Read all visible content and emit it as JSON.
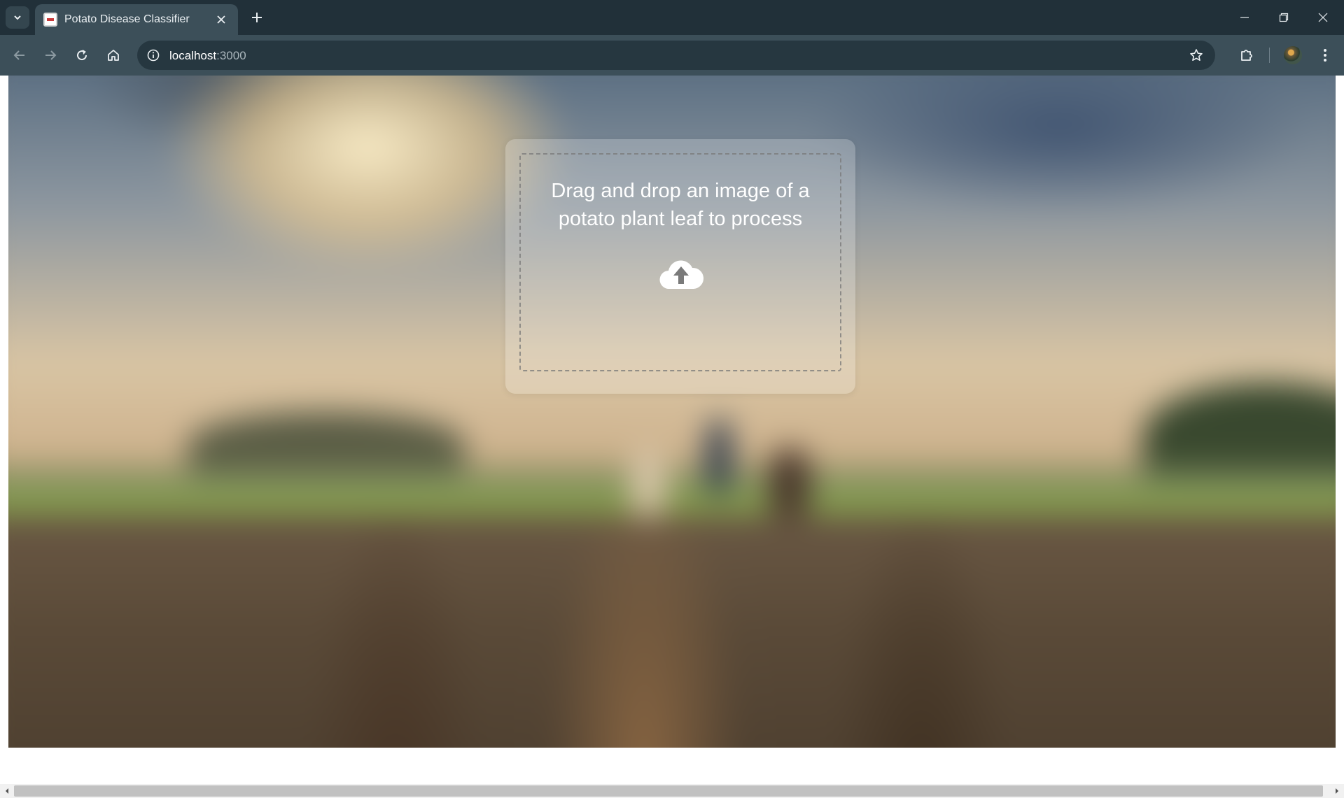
{
  "browser": {
    "tab": {
      "title": "Potato Disease Classifier"
    },
    "address": {
      "host": "localhost",
      "port": ":3000"
    }
  },
  "icons": {
    "tab_search": "chevron-down-icon",
    "close_tab": "close-icon",
    "new_tab": "plus-icon",
    "back": "arrow-left-icon",
    "forward": "arrow-right-icon",
    "reload": "reload-icon",
    "home": "home-icon",
    "site_info": "info-icon",
    "bookmark": "star-icon",
    "extensions": "puzzle-icon",
    "menu": "kebab-menu-icon",
    "upload": "cloud-upload-icon"
  },
  "dropzone": {
    "message": "Drag and drop an image of a potato plant leaf to process"
  },
  "colors": {
    "tabbar": "#213039",
    "toolbar": "#3c4f59",
    "omnibox": "#263740",
    "card_overlay": "rgba(255,255,255,0.22)"
  }
}
